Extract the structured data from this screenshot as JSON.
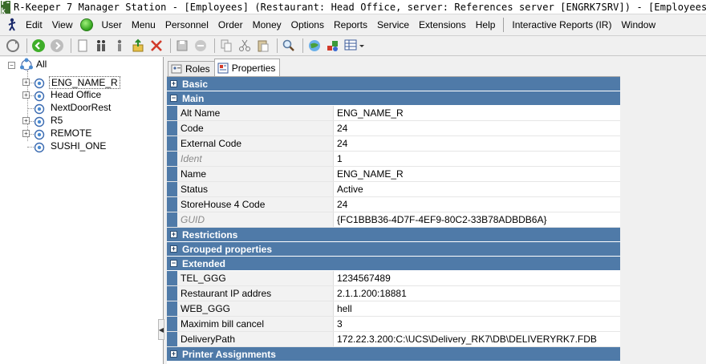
{
  "window": {
    "logo_text": "r-k",
    "title": "R-Keeper 7 Manager Station - [Employees] (Restaurant: Head Office, server: References server [ENGRK7SRV]) - [Employees]"
  },
  "menu": [
    {
      "label": "Edit",
      "u": "E"
    },
    {
      "label": "View",
      "u": "V"
    },
    {
      "label": "User",
      "u": "U"
    },
    {
      "label": "Menu",
      "u": "M"
    },
    {
      "label": "Personnel",
      "u": "P"
    },
    {
      "label": "Order",
      "u": "O"
    },
    {
      "label": "Money",
      "u": "M"
    },
    {
      "label": "Options",
      "u": "O"
    },
    {
      "label": "Reports",
      "u": "R"
    },
    {
      "label": "Service",
      "u": "S"
    },
    {
      "label": "Extensions",
      "u": "E"
    },
    {
      "label": "Help",
      "u": "H"
    },
    {
      "label": "Interactive Reports (IR)",
      "u": ""
    },
    {
      "label": "Window",
      "u": "W"
    }
  ],
  "tree": {
    "root": "All",
    "items": [
      "ENG_NAME_R",
      "Head Office",
      "NextDoorRest",
      "R5",
      "REMOTE",
      "SUSHI_ONE"
    ]
  },
  "tabs": {
    "roles": "Roles",
    "properties": "Properties"
  },
  "grid": {
    "sections": [
      {
        "title": "Basic",
        "expanded": false,
        "rows": []
      },
      {
        "title": "Main",
        "expanded": true,
        "rows": [
          {
            "name": "Alt Name",
            "value": "ENG_NAME_R",
            "readonly": false
          },
          {
            "name": "Code",
            "value": "24",
            "readonly": false
          },
          {
            "name": "External Code",
            "value": "24",
            "readonly": false
          },
          {
            "name": "Ident",
            "value": "1",
            "readonly": true
          },
          {
            "name": "Name",
            "value": "ENG_NAME_R",
            "readonly": false
          },
          {
            "name": "Status",
            "value": "Active",
            "readonly": false
          },
          {
            "name": "StoreHouse 4 Code",
            "value": "24",
            "readonly": false
          },
          {
            "name": "GUID",
            "value": "{FC1BBB36-4D7F-4EF9-80C2-33B78ADBDB6A}",
            "readonly": true
          }
        ]
      },
      {
        "title": "Restrictions",
        "expanded": false,
        "rows": []
      },
      {
        "title": "Grouped properties",
        "expanded": false,
        "rows": []
      },
      {
        "title": "Extended",
        "expanded": true,
        "rows": [
          {
            "name": "TEL_GGG",
            "value": "1234567489",
            "readonly": false
          },
          {
            "name": "Restaurant IP addres",
            "value": "2.1.1.200:18881",
            "readonly": false
          },
          {
            "name": "WEB_GGG",
            "value": "hell",
            "readonly": false
          },
          {
            "name": "Maximim bill cancel",
            "value": "3",
            "readonly": false
          },
          {
            "name": "DeliveryPath",
            "value": "172.22.3.200:C:\\UCS\\Delivery_RK7\\DB\\DELIVERYRK7.FDB",
            "readonly": false
          }
        ]
      },
      {
        "title": "Printer Assignments",
        "expanded": false,
        "rows": []
      }
    ]
  },
  "colors": {
    "category_bg": "#4f7aa8",
    "readonly_text": "#8a8a8a"
  }
}
